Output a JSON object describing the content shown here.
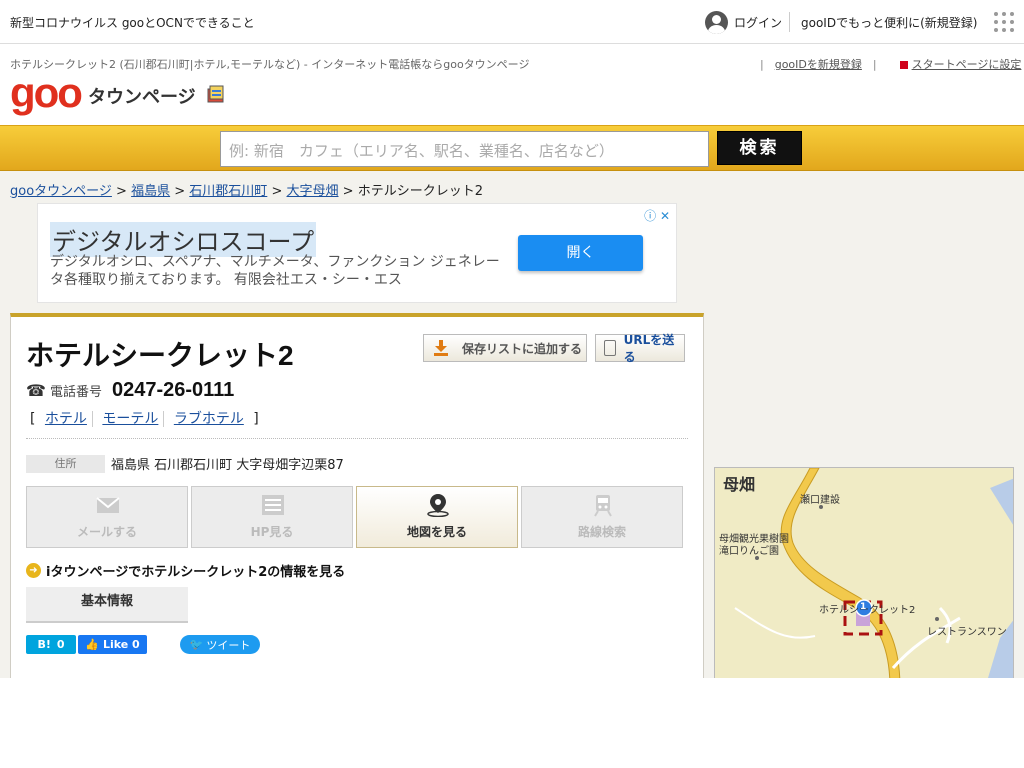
{
  "topbar": {
    "notice": "新型コロナウイルス gooとOCNでできること",
    "login_label": "ログイン",
    "promo": "gooIDでもっと便利に(新規登録)"
  },
  "header": {
    "description": "ホテルシークレット2 (石川郡石川町|ホテル,モーテルなど) - インターネット電話帳ならgooタウンページ",
    "logo_text": "goo",
    "logo_sub": "タウンページ",
    "register_link": "gooIDを新規登録",
    "startpage_link": "スタートページに設定"
  },
  "search": {
    "placeholder": "例: 新宿　カフェ（エリア名、駅名、業種名、店名など）",
    "button": "検索"
  },
  "breadcrumb": {
    "items": [
      "gooタウンページ",
      "福島県",
      "石川郡石川町",
      "大字母畑"
    ],
    "current": "ホテルシークレット2",
    "separator": ">"
  },
  "ad": {
    "title": "デジタルオシロスコープ",
    "text": "デジタルオシロ、スペアナ、マルチメータ、ファンクション ジェネレータ各種取り揃えております。 有限会社エス・シー・エス",
    "button": "開く",
    "close_mark": "ⓘ ✕"
  },
  "listing": {
    "name": "ホテルシークレット2",
    "save_button": "保存リストに追加する",
    "url_button": "URLを送る",
    "phone_label": "電話番号",
    "phone": "0247-26-0111",
    "tags": [
      "ホテル",
      "モーテル",
      "ラブホテル"
    ],
    "address_label": "住所",
    "address": "福島県 石川郡石川町 大字母畑字辺栗87",
    "actions": [
      {
        "label": "メールする",
        "active": false
      },
      {
        "label": "HP見る",
        "active": false
      },
      {
        "label": "地図を見る",
        "active": true
      },
      {
        "label": "路線検索",
        "active": false
      }
    ],
    "itown_text": "iタウンページでホテルシークレット2の情報を見る",
    "basic_info_tab": "基本情報",
    "hatena_count": "0",
    "fb_like": "Like 0",
    "tweet": "ツイート"
  },
  "map": {
    "labels": [
      "母畑",
      "瀬口建設",
      "母畑観光果樹園",
      "滝口りんご園",
      "ホテルシークレット2",
      "レストランスワン"
    ],
    "marker_number": "1",
    "colors": {
      "road": "#f2c94c",
      "water": "#b8cce8",
      "land": "#f0ebc5"
    }
  },
  "colors": {
    "accent_yellow": "#e8b51c",
    "logo_red": "#e0301e",
    "link_blue": "#1a4f9c"
  }
}
